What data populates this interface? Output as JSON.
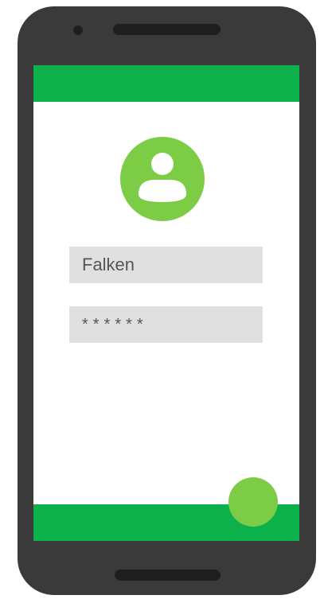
{
  "login": {
    "username_value": "Falken",
    "password_value": "******"
  },
  "icons": {
    "avatar": "user-avatar-icon",
    "fab": "floating-action-button"
  },
  "colors": {
    "phone_body": "#3a3a3a",
    "phone_details": "#1e1e1e",
    "app_bar": "#0db14b",
    "accent": "#7dcc46",
    "field_bg": "#e0e0e0",
    "field_text": "#555555",
    "screen_bg": "#ffffff"
  }
}
